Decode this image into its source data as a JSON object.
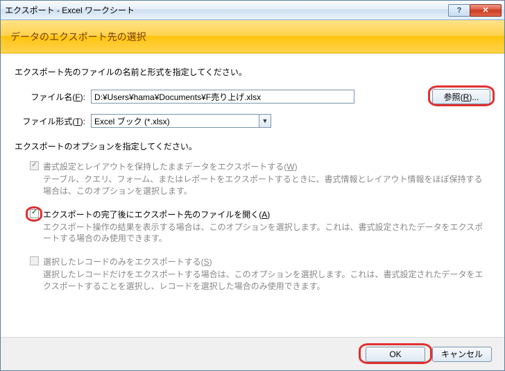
{
  "window": {
    "title": "エクスポート - Excel ワークシート"
  },
  "header": {
    "title": "データのエクスポート先の選択"
  },
  "instructions": {
    "line1": "エクスポート先のファイルの名前と形式を指定してください。"
  },
  "fields": {
    "filename_label": "ファイル名(F):",
    "filename_value": "D:¥Users¥hama¥Documents¥F売り上げ.xlsx",
    "browse_label": "参照(R)...",
    "fileformat_label": "ファイル形式(T):",
    "fileformat_value": "Excel ブック (*.xlsx)"
  },
  "options": {
    "section_label": "エクスポートのオプションを指定してください。",
    "opt1": {
      "title": "書式設定とレイアウトを保持したままデータをエクスポートする(W)",
      "desc": "テーブル、クエリ、フォーム、またはレポートをエクスポートするときに、書式情報とレイアウト情報をほぼ保持する場合は、このオプションを選択します。",
      "checked": true,
      "disabled": true
    },
    "opt2": {
      "title": "エクスポートの完了後にエクスポート先のファイルを開く(A)",
      "desc": "エクスポート操作の結果を表示する場合は、このオプションを選択します。これは、書式設定されたデータをエクスポートする場合のみ使用できます。",
      "checked": true,
      "disabled": false
    },
    "opt3": {
      "title": "選択したレコードのみをエクスポートする(S)",
      "desc": "選択したレコードだけをエクスポートする場合は、このオプションを選択します。これは、書式設定されたデータをエクスポートすることを選択し、レコードを選択した場合のみ使用できます。",
      "checked": false,
      "disabled": true
    }
  },
  "footer": {
    "ok": "OK",
    "cancel": "キャンセル"
  }
}
